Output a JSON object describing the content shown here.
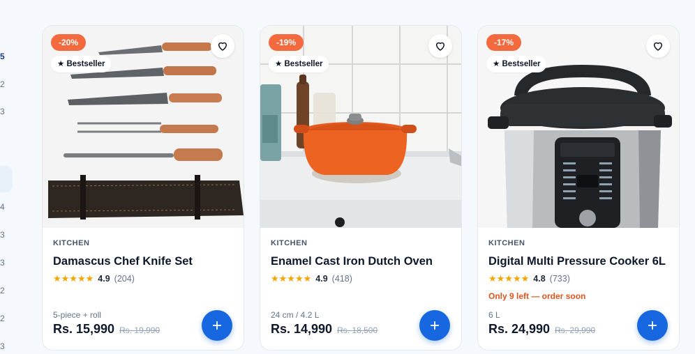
{
  "left_column": {
    "numbers": [
      "5",
      "2",
      "3",
      "4",
      "3",
      "3",
      "2",
      "2",
      "3"
    ]
  },
  "colors": {
    "accent": "#1768e0",
    "discount": "#f26a3d",
    "star": "#f5a300",
    "stock_warning": "#e0551f"
  },
  "products": [
    {
      "discount": "-20%",
      "badge": "★ Bestseller",
      "category": "KITCHEN",
      "title": "Damascus Chef Knife Set",
      "stars": "★★★★★",
      "score": "4.9",
      "reviews": "(204)",
      "stock_note": "",
      "variant": "5-piece + roll",
      "price": "Rs. 15,990",
      "was_price": "Rs. 19,990",
      "image_icon": "knife-set-image"
    },
    {
      "discount": "-19%",
      "badge": "★ Bestseller",
      "category": "KITCHEN",
      "title": "Enamel Cast Iron Dutch Oven",
      "stars": "★★★★★",
      "score": "4.9",
      "reviews": "(418)",
      "stock_note": "",
      "variant": "24 cm / 4.2 L",
      "price": "Rs. 14,990",
      "was_price": "Rs. 18,500",
      "image_icon": "dutch-oven-image"
    },
    {
      "discount": "-17%",
      "badge": "★ Bestseller",
      "category": "KITCHEN",
      "title": "Digital Multi Pressure Cooker 6L",
      "stars": "★★★★★",
      "score": "4.8",
      "reviews": "(733)",
      "stock_note": "Only 9 left — order soon",
      "variant": "6 L",
      "price": "Rs. 24,990",
      "was_price": "Rs. 29,990",
      "image_icon": "pressure-cooker-image"
    }
  ]
}
